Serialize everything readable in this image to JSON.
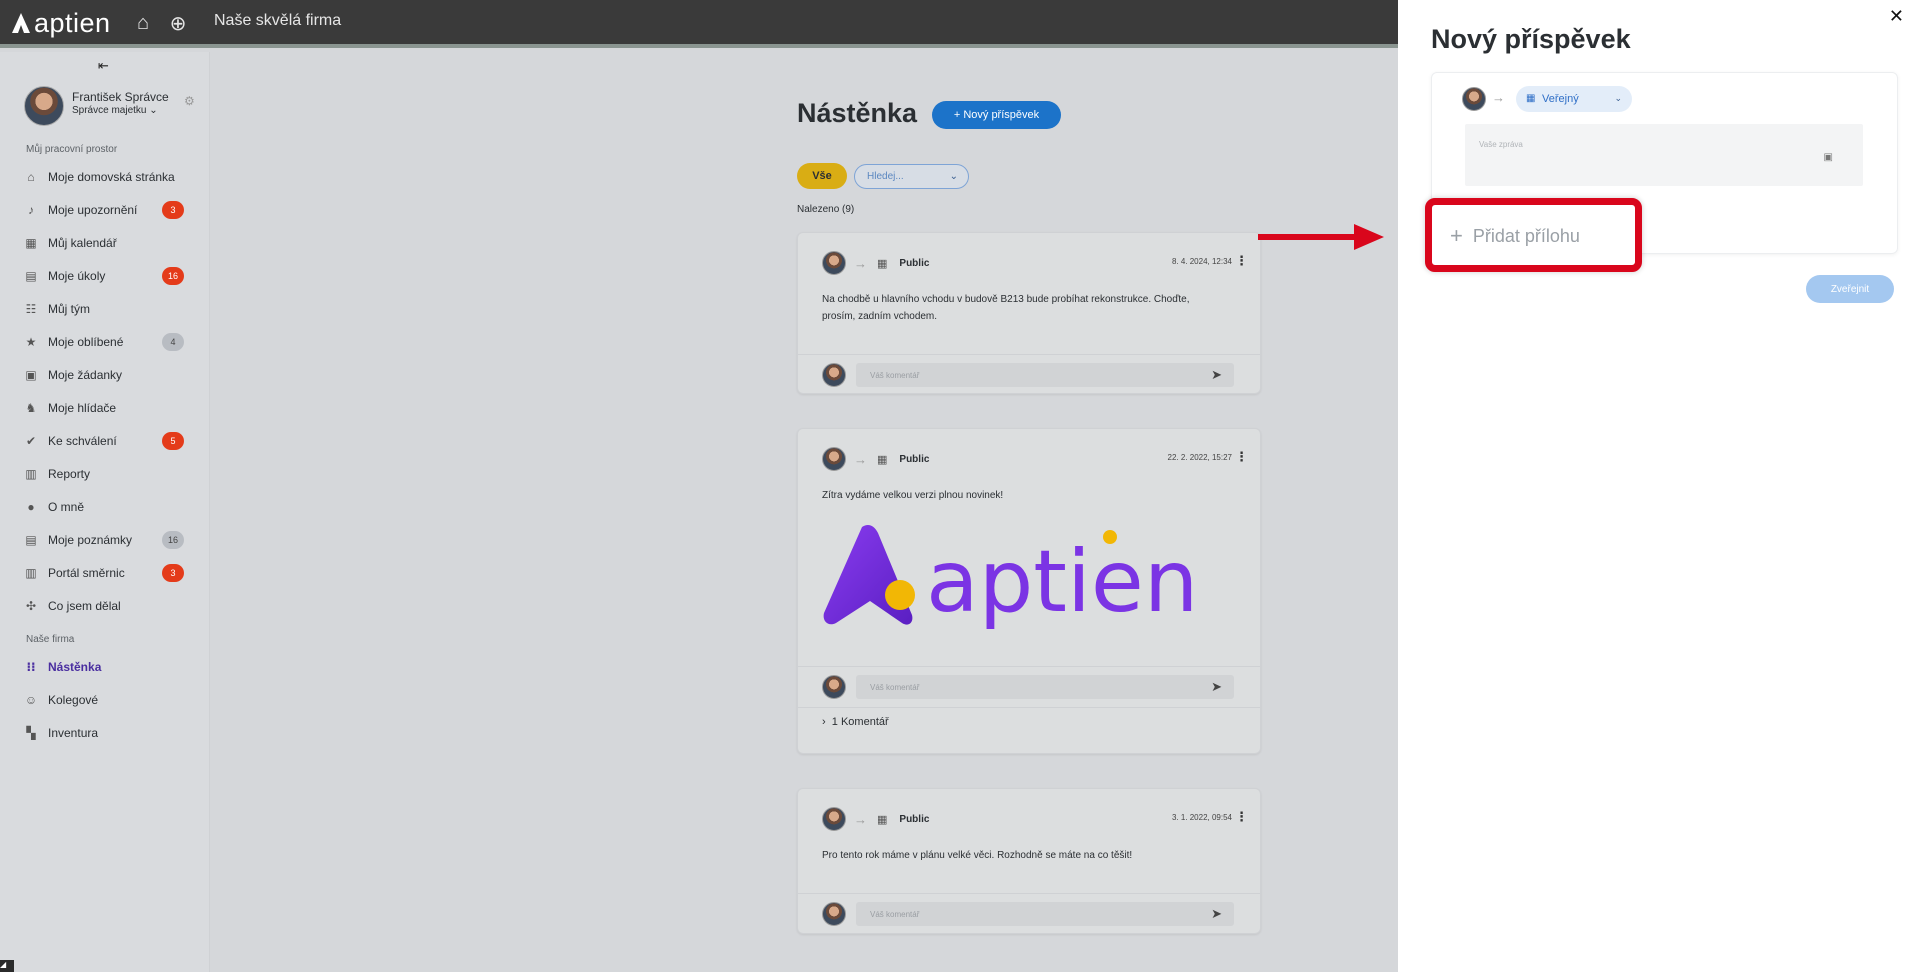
{
  "topbar": {
    "brand": "aptien",
    "company": "Naše skvělá firma"
  },
  "sidebar": {
    "user": {
      "name": "František Správce",
      "role": "Správce majetku"
    },
    "section_workspace": "Můj pracovní prostor",
    "items": [
      {
        "label": "Moje domovská stránka",
        "icon": "home-icon"
      },
      {
        "label": "Moje upozornění",
        "icon": "bell-icon",
        "badge": "3"
      },
      {
        "label": "Můj kalendář",
        "icon": "calendar-icon"
      },
      {
        "label": "Moje úkoly",
        "icon": "tasks-icon",
        "badge": "16"
      },
      {
        "label": "Můj tým",
        "icon": "team-icon"
      },
      {
        "label": "Moje oblíbené",
        "icon": "star-icon",
        "badge": "4"
      },
      {
        "label": "Moje žádanky",
        "icon": "request-icon"
      },
      {
        "label": "Moje hlídače",
        "icon": "watchdog-icon"
      },
      {
        "label": "Ke schválení",
        "icon": "check-icon",
        "badge": "5"
      },
      {
        "label": "Reporty",
        "icon": "report-icon"
      },
      {
        "label": "O mně",
        "icon": "person-icon"
      },
      {
        "label": "Moje poznámky",
        "icon": "notes-icon",
        "badge": "16"
      },
      {
        "label": "Portál směrnic",
        "icon": "library-icon",
        "badge": "3"
      },
      {
        "label": "Co jsem dělal",
        "icon": "history-icon"
      }
    ],
    "section_company": "Naše firma",
    "company_items": [
      {
        "label": "Nástěnka",
        "icon": "board-icon",
        "active": true
      },
      {
        "label": "Kolegové",
        "icon": "colleagues-icon"
      },
      {
        "label": "Inventura",
        "icon": "inventory-icon"
      }
    ]
  },
  "main": {
    "title": "Nástěnka",
    "new_post_label": "+ Nový příspěvek",
    "filter_all": "Vše",
    "search_placeholder": "Hledej...",
    "found": "Nalezeno (9)",
    "posts": [
      {
        "audience": "Public",
        "date": "8. 4. 2024, 12:34",
        "text": "Na chodbě u hlavního vchodu v budově B213 bude probíhat rekonstrukce. Choďte, prosím, zadním vchodem.",
        "comment_placeholder": "Váš komentář"
      },
      {
        "audience": "Public",
        "date": "22. 2. 2022, 15:27",
        "text": "Zítra vydáme velkou verzi plnou novinek!",
        "image_text": "aptien",
        "comment_placeholder": "Váš komentář",
        "comments_link": "1 Komentář"
      },
      {
        "audience": "Public",
        "date": "3. 1. 2022, 09:54",
        "text": "Pro tento rok máme v plánu velké věci. Rozhodně se máte na co těšit!",
        "comment_placeholder": "Váš komentář"
      }
    ]
  },
  "panel": {
    "title": "Nový příspěvek",
    "visibility": "Veřejný",
    "message_placeholder": "Vaše zpráva",
    "attach_label": "Přidat přílohu",
    "publish_label": "Zveřejnit"
  },
  "colors": {
    "accent": "#1c73c9",
    "highlight": "#d9061c",
    "brand_purple": "#6a2bd9"
  }
}
